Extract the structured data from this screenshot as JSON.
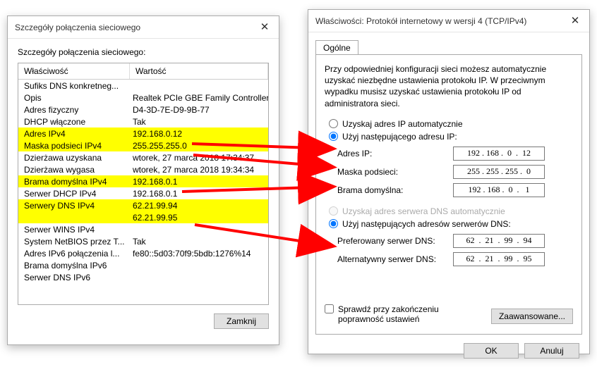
{
  "left": {
    "title": "Szczegóły połączenia sieciowego",
    "subhead": "Szczegóły połączenia sieciowego:",
    "col1": "Właściwość",
    "col2": "Wartość",
    "rows": [
      {
        "p": "Sufiks DNS konkretneg...",
        "v": "",
        "hl": false
      },
      {
        "p": "Opis",
        "v": "Realtek PCIe GBE Family Controller",
        "hl": false
      },
      {
        "p": "Adres fizyczny",
        "v": "D4-3D-7E-D9-9B-77",
        "hl": false
      },
      {
        "p": "DHCP włączone",
        "v": "Tak",
        "hl": false
      },
      {
        "p": "Adres IPv4",
        "v": "192.168.0.12",
        "hl": true
      },
      {
        "p": "Maska podsieci IPv4",
        "v": "255.255.255.0",
        "hl": true
      },
      {
        "p": "Dzierżawa uzyskana",
        "v": "wtorek, 27 marca 2018 17:34:37",
        "hl": false
      },
      {
        "p": "Dzierżawa wygasa",
        "v": "wtorek, 27 marca 2018 19:34:34",
        "hl": false
      },
      {
        "p": "Brama domyślna IPv4",
        "v": "192.168.0.1",
        "hl": true
      },
      {
        "p": "Serwer DHCP IPv4",
        "v": "192.168.0.1",
        "hl": false
      },
      {
        "p": "Serwery DNS IPv4",
        "v": "62.21.99.94",
        "hl": true
      },
      {
        "p": "",
        "v": "62.21.99.95",
        "hl": true
      },
      {
        "p": "Serwer WINS IPv4",
        "v": "",
        "hl": false
      },
      {
        "p": "System NetBIOS przez T...",
        "v": "Tak",
        "hl": false
      },
      {
        "p": "Adres IPv6 połączenia l...",
        "v": "fe80::5d03:70f9:5bdb:1276%14",
        "hl": false
      },
      {
        "p": "Brama domyślna IPv6",
        "v": "",
        "hl": false
      },
      {
        "p": "Serwer DNS IPv6",
        "v": "",
        "hl": false
      }
    ],
    "close_btn": "Zamknij"
  },
  "right": {
    "title": "Właściwości: Protokół internetowy w wersji 4 (TCP/IPv4)",
    "tab": "Ogólne",
    "desc": "Przy odpowiedniej konfiguracji sieci możesz automatycznie uzyskać niezbędne ustawienia protokołu IP. W przeciwnym wypadku musisz uzyskać ustawienia protokołu IP od administratora sieci.",
    "radio_ip_auto": "Uzyskaj adres IP automatycznie",
    "radio_ip_manual": "Użyj następującego adresu IP:",
    "lbl_ip": "Adres IP:",
    "lbl_mask": "Maska podsieci:",
    "lbl_gateway": "Brama domyślna:",
    "radio_dns_auto": "Uzyskaj adres serwera DNS automatycznie",
    "radio_dns_manual": "Użyj następujących adresów serwerów DNS:",
    "lbl_dns1": "Preferowany serwer DNS:",
    "lbl_dns2": "Alternatywny serwer DNS:",
    "ip": "192 . 168 .  0  .  12",
    "mask": "255 . 255 . 255 .  0",
    "gateway": "192 . 168 .  0  .   1",
    "dns1": "62  .  21  .  99  .  94",
    "dns2": "62  .  21  .  99  .  95",
    "checkbox": "Sprawdź przy zakończeniu poprawność ustawień",
    "adv_btn": "Zaawansowane...",
    "ok": "OK",
    "cancel": "Anuluj"
  }
}
